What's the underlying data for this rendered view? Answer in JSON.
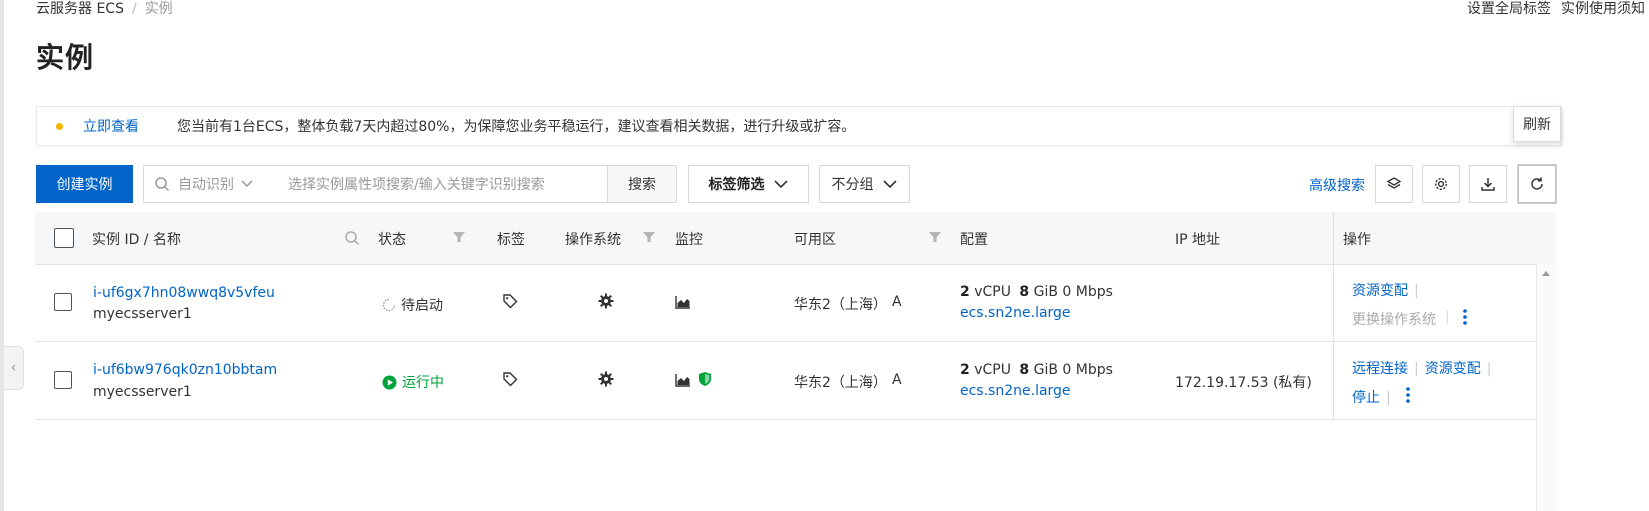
{
  "breadcrumb": {
    "parent": "云服务器 ECS",
    "separator": "/",
    "current": "实例"
  },
  "top_links": {
    "global_tags": "设置全局标签",
    "instructions": "实例使用须知"
  },
  "page_title": "实例",
  "notice": {
    "link": "立即查看",
    "message": "您当前有1台ECS，整体负载7天内超过80%，为保障您业务平稳运行，建议查看相关数据，进行升级或扩容。",
    "dot_color": "#f6b500"
  },
  "tooltip": "刷新",
  "toolbar": {
    "create_label": "创建实例",
    "search_mode": "自动识别",
    "search_placeholder": "选择实例属性项搜索/输入关键字识别搜索",
    "search_button": "搜索",
    "tag_filter": "标签筛选",
    "group": "不分组",
    "advanced_search": "高级搜索"
  },
  "columns": {
    "id_name": "实例 ID / 名称",
    "status": "状态",
    "tags": "标签",
    "os": "操作系统",
    "monitor": "监控",
    "zone": "可用区",
    "config": "配置",
    "ip": "IP 地址",
    "actions": "操作"
  },
  "rows": [
    {
      "id": "i-uf6gx7hn08wwq8v5vfeu",
      "name": "myecsserver1",
      "status": "待启动",
      "zone_name": "华东2（上海）",
      "zone_letter": "A",
      "vcpu": "2",
      "vcpu_unit": "vCPU",
      "mem": "8",
      "mem_unit": "GiB",
      "bandwidth": "0 Mbps",
      "spec": "ecs.sn2ne.large",
      "ip": "",
      "action1": "资源变配",
      "action2": "更换操作系统"
    },
    {
      "id": "i-uf6bw976qk0zn10bbtam",
      "name": "myecsserver1",
      "status": "运行中",
      "zone_name": "华东2（上海）",
      "zone_letter": "A",
      "vcpu": "2",
      "vcpu_unit": "vCPU",
      "mem": "8",
      "mem_unit": "GiB",
      "bandwidth": "0 Mbps",
      "spec": "ecs.sn2ne.large",
      "ip": "172.19.17.53 (私有)",
      "action1": "远程连接",
      "action2": "资源变配",
      "action3": "停止"
    }
  ],
  "colors": {
    "primary": "#0064c8",
    "running": "#00a33b",
    "header_bg": "#f6f7f8"
  }
}
